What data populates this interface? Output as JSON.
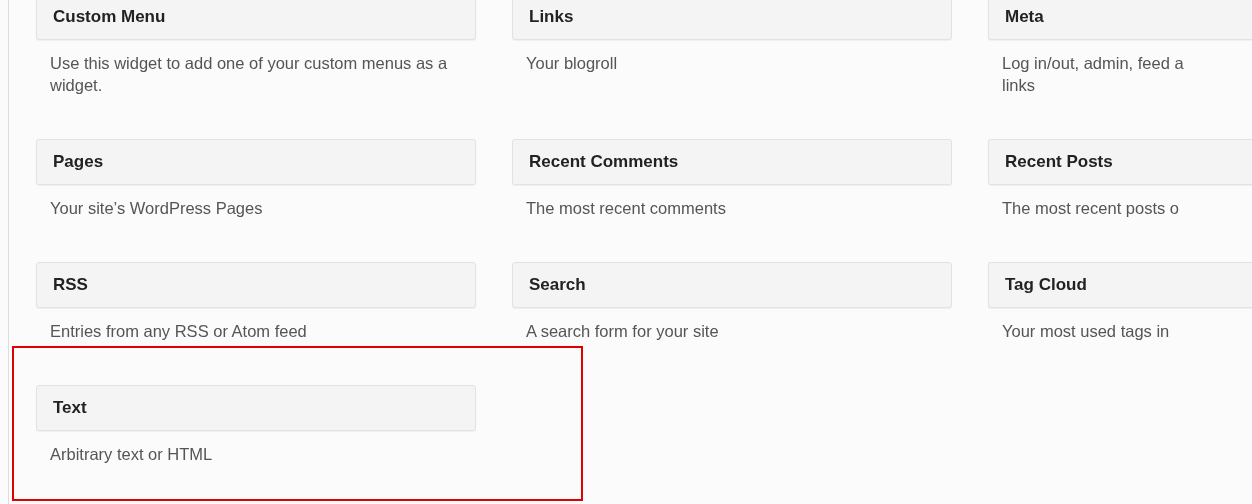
{
  "widgets": [
    {
      "title": "Custom Menu",
      "description": "Use this widget to add one of your custom menus as a widget.",
      "highlighted": false
    },
    {
      "title": "Links",
      "description": "Your blogroll",
      "highlighted": false
    },
    {
      "title": "Meta",
      "description": "Log in/out, admin, feed a\nlinks",
      "highlighted": false
    },
    {
      "title": "Pages",
      "description": "Your site’s WordPress Pages",
      "highlighted": false
    },
    {
      "title": "Recent Comments",
      "description": "The most recent comments",
      "highlighted": false
    },
    {
      "title": "Recent Posts",
      "description": "The most recent posts o",
      "highlighted": false
    },
    {
      "title": "RSS",
      "description": "Entries from any RSS or Atom feed",
      "highlighted": false
    },
    {
      "title": "Search",
      "description": "A search form for your site",
      "highlighted": false
    },
    {
      "title": "Tag Cloud",
      "description": "Your most used tags in",
      "highlighted": false
    },
    {
      "title": "Text",
      "description": "Arbitrary text or HTML",
      "highlighted": true
    }
  ]
}
